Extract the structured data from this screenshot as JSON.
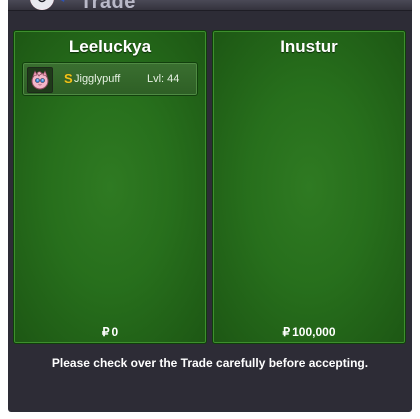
{
  "window": {
    "title": "Trade"
  },
  "left_panel": {
    "player_name": "Leeluckya",
    "items": [
      {
        "shiny_badge": "S",
        "pokemon_name": "Jigglypuff",
        "level_text": "Lvl: 44",
        "sprite_icon": "jigglypuff-sprite-icon"
      }
    ],
    "currency_symbol": "₽",
    "money": "0"
  },
  "right_panel": {
    "player_name": "Inustur",
    "items": [],
    "currency_symbol": "₽",
    "money": "100,000"
  },
  "footer": {
    "notice": "Please check over the Trade carefully before accepting."
  },
  "colors": {
    "panel_green": "#276f1c",
    "window_bg": "#2d2c36",
    "shiny_gold": "#f0c419"
  }
}
